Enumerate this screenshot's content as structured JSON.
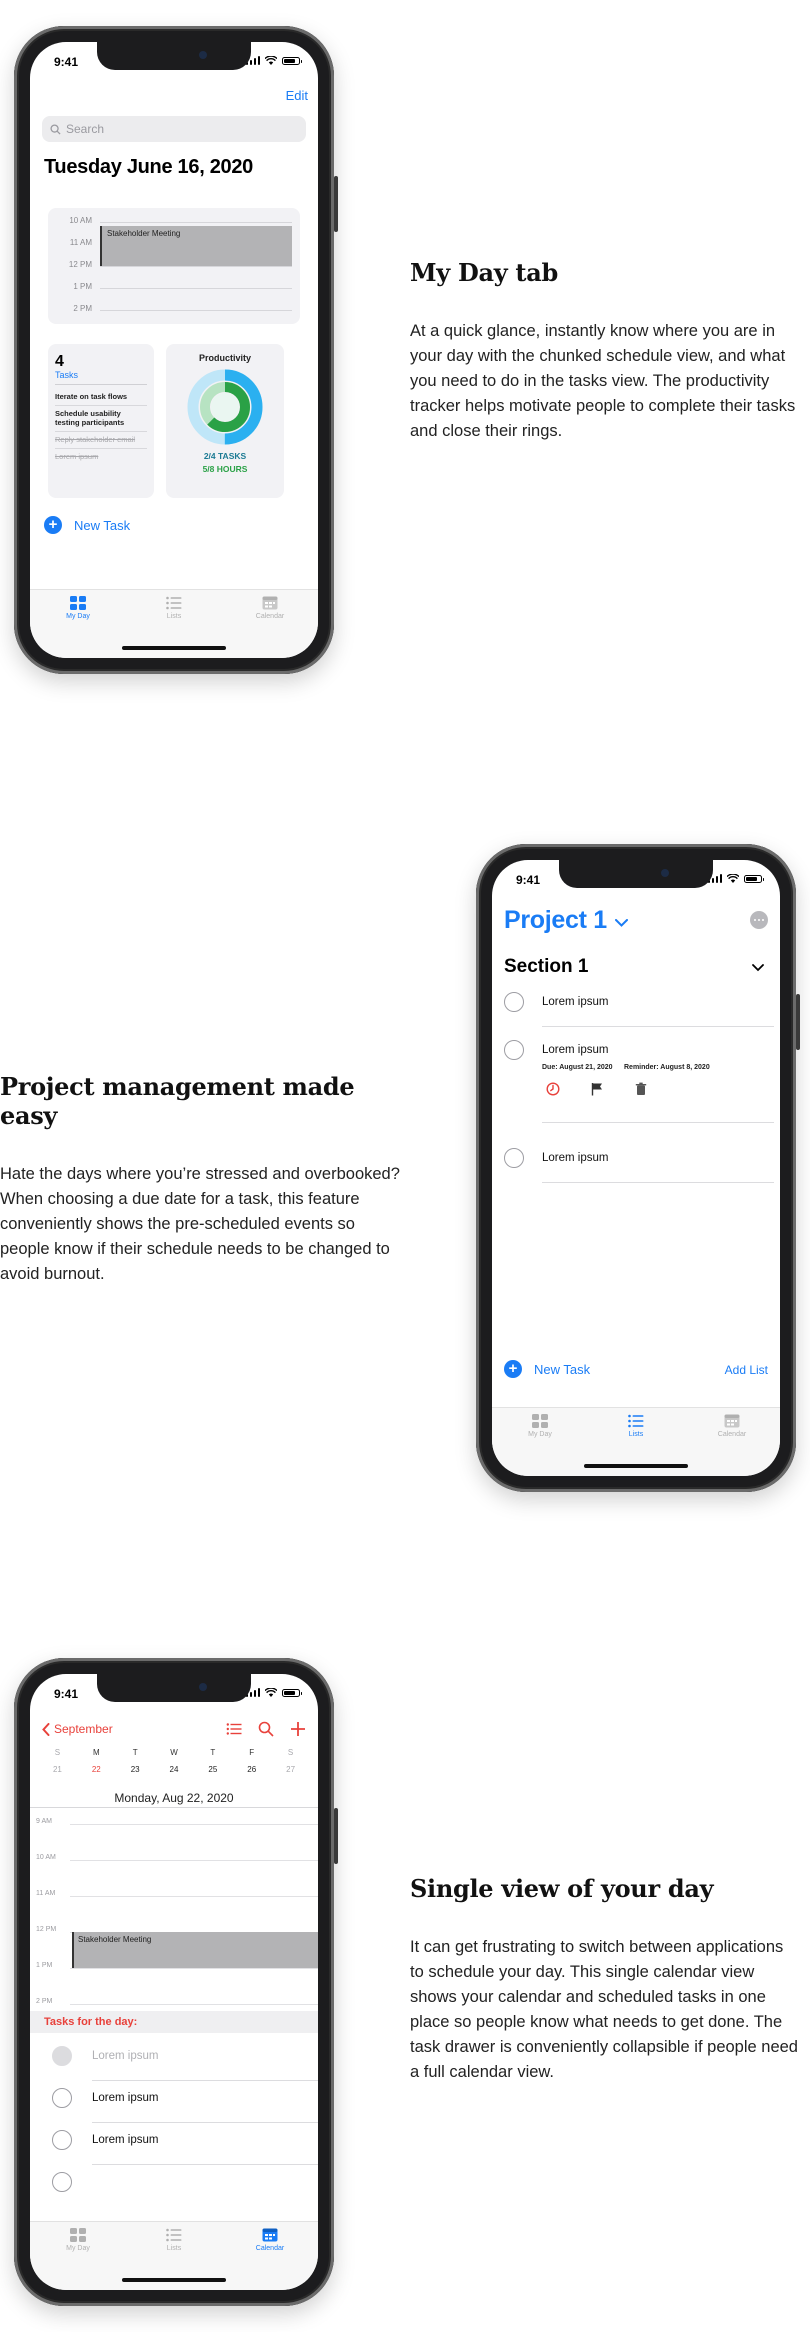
{
  "sections": [
    {
      "heading": "My Day tab",
      "body": "At a quick glance, instantly know where you are in your day with the chunked schedule view, and what you need to do in the tasks view. The productivity tracker helps motivate people to complete their tasks and close their rings."
    },
    {
      "heading": "Project management made easy",
      "body": "Hate the days where you’re stressed and overbooked? When choosing a due date for a task, this feature conveniently shows the pre-scheduled events so people know if their schedule needs to be changed to avoid burnout."
    },
    {
      "heading": "Single view of your day",
      "body": "It can get frustrating to switch between applications to schedule your day. This single calendar view shows your calendar and scheduled tasks in one place so people know what needs to get done. The task drawer is conveniently collapsible if people need a full calendar view."
    }
  ],
  "status_time": "9:41",
  "tabs": [
    "My Day",
    "Lists",
    "Calendar"
  ],
  "my_day": {
    "edit_label": "Edit",
    "search_placeholder": "Search",
    "date_title": "Tuesday June 16, 2020",
    "schedule_hours": [
      "10 AM",
      "11 AM",
      "12 PM",
      "1 PM",
      "2 PM"
    ],
    "meeting_title": "Stakeholder Meeting",
    "tasks_count": "4",
    "tasks_label": "Tasks",
    "tasks": [
      {
        "text": "Iterate on task flows",
        "done": false
      },
      {
        "text": "Schedule usability testing participants",
        "done": false
      },
      {
        "text": "Reply stakeholder email",
        "done": true
      },
      {
        "text": "Lorem ipsum",
        "done": true
      }
    ],
    "productivity_title": "Productivity",
    "productivity_tasks": "2/4 TASKS",
    "productivity_hours": "5/8 HOURS",
    "tasks_fraction": 0.5,
    "hours_fraction": 0.625,
    "new_task_label": "New Task",
    "colors": {
      "accent": "#1a7cf5",
      "ring_blue": "#2bb0f0",
      "ring_green": "#2aa146"
    }
  },
  "project": {
    "title": "Project 1",
    "section_title": "Section 1",
    "tasks": [
      "Lorem ipsum",
      "Lorem ipsum",
      "Lorem ipsum"
    ],
    "due_label": "Due: August 21, 2020",
    "reminder_label": "Reminder: August 8, 2020",
    "action_icons": [
      "clock-icon",
      "flag-icon",
      "trash-icon"
    ],
    "new_task_label": "New Task",
    "add_list_label": "Add List"
  },
  "calendar": {
    "back_label": "September",
    "tool_icons": [
      "list-icon",
      "search-icon",
      "plus-icon"
    ],
    "weekdays": [
      "S",
      "M",
      "T",
      "W",
      "T",
      "F",
      "S"
    ],
    "dates": [
      "21",
      "22",
      "23",
      "24",
      "25",
      "26",
      "27"
    ],
    "today_index": 1,
    "date_title": "Monday, Aug 22, 2020",
    "hours": [
      "9 AM",
      "10 AM",
      "11 AM",
      "12 PM",
      "1 PM",
      "2 PM"
    ],
    "event_title": "Stakeholder Meeting",
    "drawer_title": "Tasks for the day:",
    "drawer_tasks": [
      {
        "text": "Lorem ipsum",
        "done": true
      },
      {
        "text": "Lorem ipsum",
        "done": false
      },
      {
        "text": "Lorem ipsum",
        "done": false
      }
    ],
    "colors": {
      "accent_red": "#e8413b"
    }
  }
}
